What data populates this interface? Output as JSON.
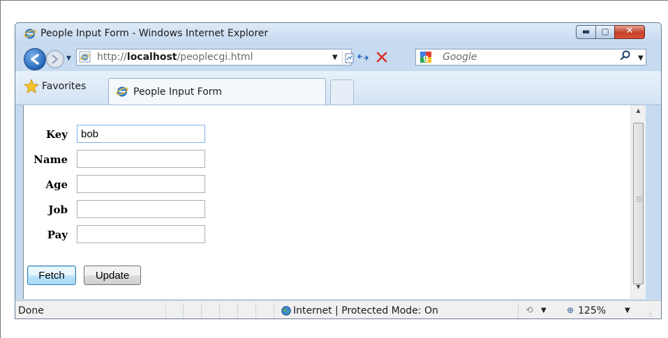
{
  "window": {
    "title": "People Input Form - Windows Internet Explorer",
    "controls": {
      "minimize": "▬",
      "maximize": "▢",
      "close": "✕"
    }
  },
  "navbar": {
    "address_prefix": "http://",
    "address_host": "localhost",
    "address_path": "/peoplecgi.html",
    "search_placeholder": "Google"
  },
  "favorites": {
    "label": "Favorites"
  },
  "tabs": [
    {
      "label": "People Input Form"
    }
  ],
  "form": {
    "fields": [
      {
        "label": "Key",
        "value": "bob"
      },
      {
        "label": "Name",
        "value": ""
      },
      {
        "label": "Age",
        "value": ""
      },
      {
        "label": "Job",
        "value": ""
      },
      {
        "label": "Pay",
        "value": ""
      }
    ],
    "buttons": {
      "fetch": "Fetch",
      "update": "Update"
    }
  },
  "statusbar": {
    "status": "Done",
    "zone": "Internet | Protected Mode: On",
    "zoom": "125%"
  },
  "colors": {
    "accent": "#2366b9",
    "titlebar": "#c6daf0",
    "close_button": "#c4412a"
  }
}
